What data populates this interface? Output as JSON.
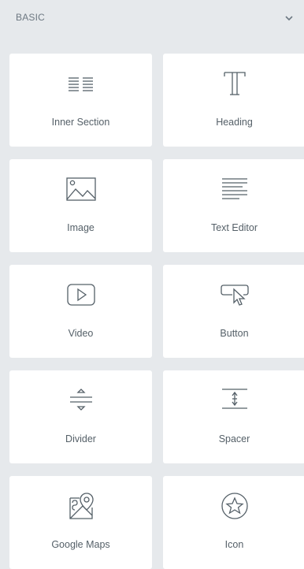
{
  "panel": {
    "section_title": "BASIC",
    "collapse_icon": "chevron-down-icon"
  },
  "widgets": [
    {
      "label": "Inner Section",
      "icon": "inner-section-icon"
    },
    {
      "label": "Heading",
      "icon": "heading-icon"
    },
    {
      "label": "Image",
      "icon": "image-icon"
    },
    {
      "label": "Text Editor",
      "icon": "text-editor-icon"
    },
    {
      "label": "Video",
      "icon": "video-icon"
    },
    {
      "label": "Button",
      "icon": "button-icon"
    },
    {
      "label": "Divider",
      "icon": "divider-icon"
    },
    {
      "label": "Spacer",
      "icon": "spacer-icon"
    },
    {
      "label": "Google Maps",
      "icon": "google-maps-icon"
    },
    {
      "label": "Icon",
      "icon": "icon-widget-icon"
    }
  ],
  "colors": {
    "panel_background": "#e6e9ec",
    "tile_background": "#ffffff",
    "text": "#556068",
    "icon_stroke": "#556068"
  }
}
